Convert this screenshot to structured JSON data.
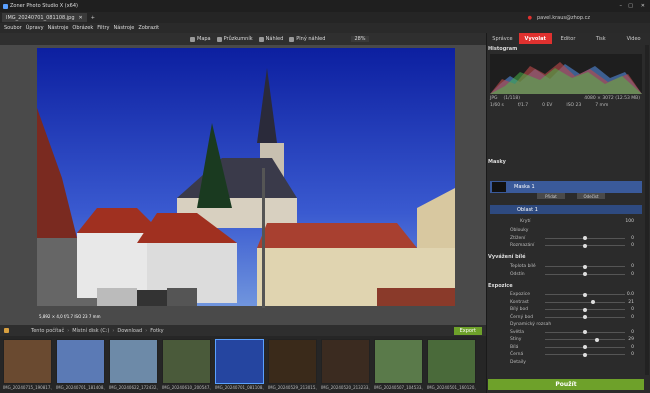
{
  "app": {
    "title": "Zoner Photo Studio X (x64)"
  },
  "tabbar": {
    "active_tab": "IMG_20240701_081108.jpg",
    "add": "+",
    "user": "pavel.kraus@zhop.cz"
  },
  "menu": {
    "items": [
      "Soubor",
      "Úpravy",
      "Nástroje",
      "Obrázek",
      "Filtry",
      "Nástroje",
      "Zobrazit"
    ]
  },
  "toolbar": {
    "map": "Mapa",
    "compare": "Průzkumník",
    "preview": "Náhled",
    "fullscreen": "Plný náhled",
    "zoom": "28%"
  },
  "mode_tabs": [
    {
      "label": "Správce",
      "active": false
    },
    {
      "label": "Vyvolat",
      "active": true
    },
    {
      "label": "Editor",
      "active": false
    },
    {
      "label": "Tisk",
      "active": false
    },
    {
      "label": "Video",
      "active": false
    }
  ],
  "histogram": {
    "title": "Histogram",
    "format": "JPG",
    "file": "(1/118)",
    "dims": "4080 × 3072 (12.53 MB)",
    "iso": "ISO 23",
    "time": "7 mm",
    "exp": "1/60 s",
    "ap": "f/1.7",
    "ev": "0 EV"
  },
  "masks": {
    "title": "Masky",
    "mask_name": "Maska 1",
    "area_name": "Oblast 1",
    "add_label": "Přidat",
    "subtract_label": "Odečíst",
    "opacity_label": "Krytí",
    "opacity_value": "100"
  },
  "rows_a": [
    {
      "label": "Oblouky",
      "value": ""
    },
    {
      "label": "Ztížení",
      "value": "0"
    },
    {
      "label": "Rozmazání",
      "value": "0"
    }
  ],
  "wb": {
    "title": "Vyvážení bílé",
    "rows": [
      {
        "label": "Teplota bílé",
        "value": "0"
      },
      {
        "label": "Odstín",
        "value": "0"
      }
    ]
  },
  "expo": {
    "title": "Expozice",
    "rows": [
      {
        "label": "Expozice",
        "value": "0.0"
      },
      {
        "label": "Kontrast",
        "value": "21"
      },
      {
        "label": "Bílý bod",
        "value": "0"
      },
      {
        "label": "Černý bod",
        "value": "0"
      },
      {
        "label": "Dynamický rozsah",
        "value": ""
      },
      {
        "label": "Světla",
        "value": "0"
      },
      {
        "label": "Stíny",
        "value": "29"
      },
      {
        "label": "Bílá",
        "value": "0"
      },
      {
        "label": "Černá",
        "value": "0"
      },
      {
        "label": "Detaily",
        "value": ""
      }
    ]
  },
  "image_info": {
    "text": "5,892 × 4,0   f/1.7   ISO 23   7 mm"
  },
  "browser": {
    "path": [
      "Tento počítač",
      "Místní disk (C:)",
      "Download",
      "Fotky"
    ],
    "export": "Export"
  },
  "filmstrip": {
    "items": [
      {
        "caption": "IMG_20240715_190817.jpg",
        "color": "#6a4a30"
      },
      {
        "caption": "IMG_20240701_181408.jpg",
        "color": "#5b7ab5"
      },
      {
        "caption": "IMG_20240622_172432.jpg",
        "color": "#6d8aa8"
      },
      {
        "caption": "IMG_20240610_200547.jpg",
        "color": "#4a5a3a"
      },
      {
        "caption": "IMG_20240701_081108.jpg",
        "color": "#2545a0"
      },
      {
        "caption": "IMG_20240529_213015.jpg",
        "color": "#3a2a1a"
      },
      {
        "caption": "IMG_20240520_213233.jpg",
        "color": "#3b2b20"
      },
      {
        "caption": "IMG_20240507_104533.jpg",
        "color": "#5a7a4a"
      },
      {
        "caption": "IMG_20240501_160120.jpg",
        "color": "#4a6a3a"
      }
    ]
  },
  "apply": {
    "label": "Použít"
  },
  "colors": {
    "accent": "#e0312f",
    "apply": "#6ea12a",
    "selection": "#3a5a9a"
  }
}
